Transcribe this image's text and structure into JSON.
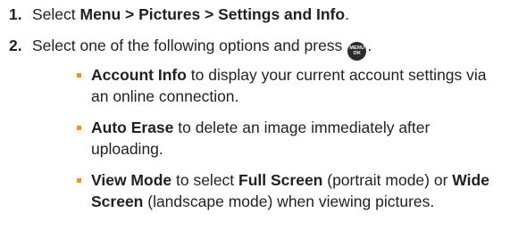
{
  "steps": [
    {
      "number": "1.",
      "prefix": "Select ",
      "menu_path": "Menu > Pictures > Settings and Info",
      "suffix": "."
    },
    {
      "number": "2.",
      "prefix": "Select one of the following options and press",
      "key_line1": "MENU",
      "key_line2": "OK",
      "suffix": "."
    }
  ],
  "options": [
    {
      "name": "Account Info",
      "text": " to display your current account settings via an online connection."
    },
    {
      "name": "Auto Erase",
      "text": " to delete an image immediately after uploading."
    },
    {
      "name_1": "View Mode",
      "text_1": " to select ",
      "name_2": "Full Screen",
      "text_2": " (portrait mode) or ",
      "name_3": "Wide Screen",
      "text_3": " (landscape mode) when viewing pictures."
    }
  ],
  "colors": {
    "text": "#231f20",
    "bullet": "#f7931e",
    "key_background": "#2b2b2b"
  },
  "icons": {
    "menu_key": "menu-ok-key-icon",
    "bullet": "square-bullet-icon"
  }
}
